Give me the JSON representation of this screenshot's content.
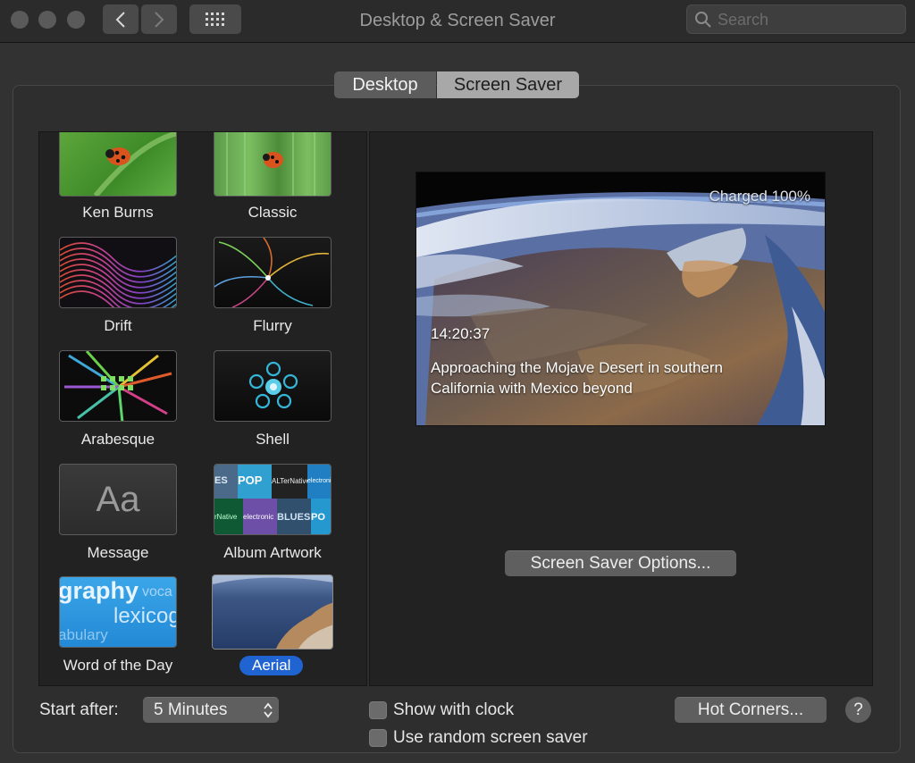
{
  "window": {
    "title": "Desktop & Screen Saver",
    "search_placeholder": "Search"
  },
  "tabs": [
    {
      "label": "Desktop",
      "selected": false
    },
    {
      "label": "Screen Saver",
      "selected": true
    }
  ],
  "screen_savers": [
    {
      "label": "Ken Burns",
      "thumb": "ladybug-icon"
    },
    {
      "label": "Classic",
      "thumb": "ladybug-icon"
    },
    {
      "label": "Drift",
      "thumb": "drift"
    },
    {
      "label": "Flurry",
      "thumb": "flurry"
    },
    {
      "label": "Arabesque",
      "thumb": "arabesque"
    },
    {
      "label": "Shell",
      "thumb": "shell"
    },
    {
      "label": "Message",
      "thumb": "message",
      "thumb_text": "Aa"
    },
    {
      "label": "Album Artwork",
      "thumb": "album-artwork",
      "tiles": [
        "ES",
        "POP",
        "ALTerNative",
        "electronic",
        "rNative",
        "electronic",
        "BLUES",
        "PO"
      ]
    },
    {
      "label": "Word of the Day",
      "thumb": "word-of-day",
      "words": [
        "graphy",
        "voca",
        "lexicog",
        "abulary"
      ]
    },
    {
      "label": "Aerial",
      "thumb": "aerial",
      "selected": true
    }
  ],
  "preview": {
    "battery": "Charged 100%",
    "time": "14:20:37",
    "caption_line1": "Approaching the Mojave Desert in southern",
    "caption_line2": "California with Mexico beyond"
  },
  "buttons": {
    "options": "Screen Saver Options...",
    "hot_corners": "Hot Corners...",
    "help": "?"
  },
  "start_after": {
    "label": "Start after:",
    "value": "5 Minutes"
  },
  "checkboxes": {
    "show_clock": "Show with clock",
    "random": "Use random screen saver"
  },
  "colors": {
    "accent": "#1f64d1",
    "background": "#323232"
  }
}
